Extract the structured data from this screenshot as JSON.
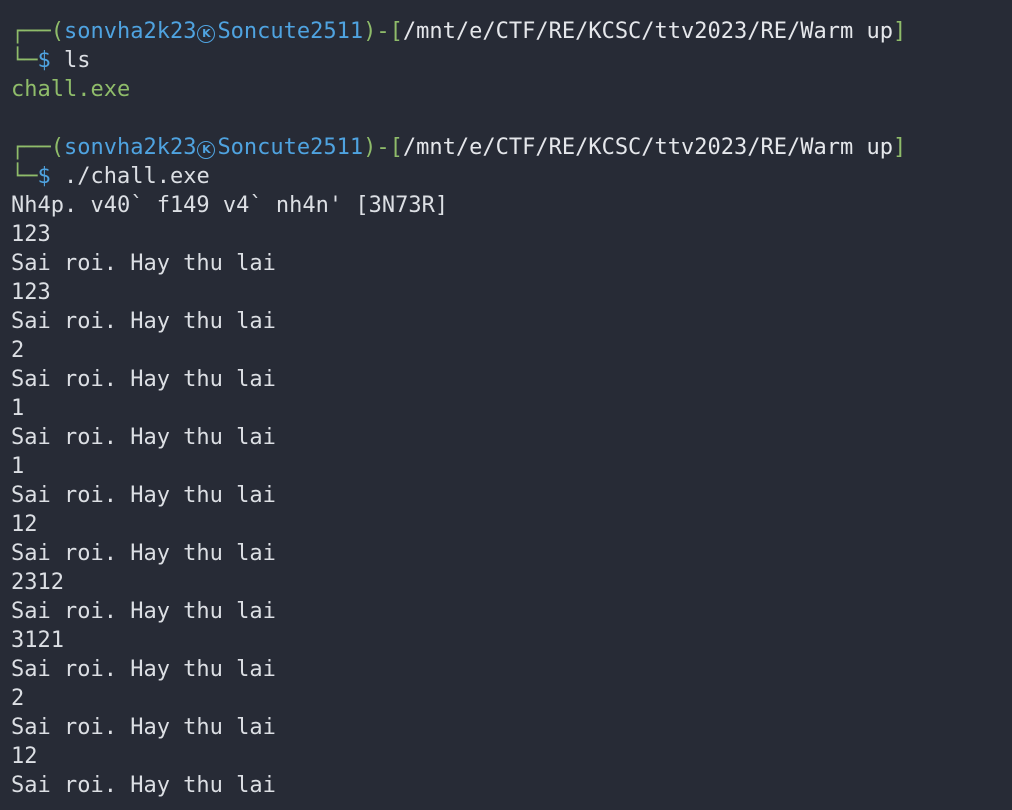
{
  "colors": {
    "background": "#272b36",
    "prompt_box": "#8fbc6a",
    "prompt_user": "#4fa3e0",
    "text": "#dcdfe4",
    "executable": "#8fbc6a"
  },
  "prompts": [
    {
      "user": "sonvha2k23",
      "host": "Soncute2511",
      "host_icon": "kali-k-icon",
      "path": "/mnt/e/CTF/RE/KCSC/ttv2023/RE/Warm up",
      "command": "ls"
    },
    {
      "user": "sonvha2k23",
      "host": "Soncute2511",
      "host_icon": "kali-k-icon",
      "path": "/mnt/e/CTF/RE/KCSC/ttv2023/RE/Warm up",
      "command": "./chall.exe"
    }
  ],
  "ls_output": "chall.exe",
  "program_output": [
    "Nh4p. v40` f149 v4` nh4n' [3N73R]",
    "123",
    "Sai roi. Hay thu lai",
    "123",
    "Sai roi. Hay thu lai",
    "2",
    "Sai roi. Hay thu lai",
    "1",
    "Sai roi. Hay thu lai",
    "1",
    "Sai roi. Hay thu lai",
    "12",
    "Sai roi. Hay thu lai",
    "2312",
    "Sai roi. Hay thu lai",
    "3121",
    "Sai roi. Hay thu lai",
    "2",
    "Sai roi. Hay thu lai",
    "12",
    "Sai roi. Hay thu lai"
  ]
}
